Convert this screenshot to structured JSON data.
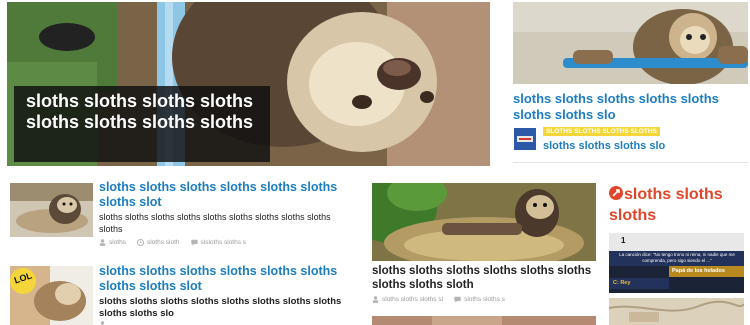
{
  "hero": {
    "caption": "sloths sloths sloths sloths sloths sloths sloths sloths"
  },
  "right_top": {
    "title": "sloths sloths sloths sloths sloths sloths sloths slo",
    "badge": "SLOTHS SLOTHS SLOTHS SLOTHS",
    "sub_title": "sloths sloths sloths slo"
  },
  "list": [
    {
      "title": "sloths sloths sloths sloths sloths sloths sloths slot",
      "desc": "sloths sloths sloths sloths sloths sloths sloths sloths sloths sloths",
      "meta": [
        "sloths",
        "sloths sloth",
        "slsloths sloths s"
      ]
    },
    {
      "badge": "LOL",
      "title": "sloths sloths sloths sloths sloths sloths sloths sloths slot",
      "desc": "sloths sloths sloths sloths sloths sloths sloths sloths sloths sloths slo"
    }
  ],
  "middle": {
    "title": "sloths sloths sloths sloths sloths sloths sloths sloths sloth",
    "meta": [
      "sloths sloths sloths sl",
      "sloths sloths s"
    ]
  },
  "right_col": {
    "heading": "sloths sloths sloths",
    "quiz": {
      "number": "1",
      "question": "La canción dice: \"No tengo trono ni reina, ni nadie que me comprenda, pero sigo siendo el ...\"",
      "answer_d": "Papá de los helados",
      "answer_c": "C: Rey"
    }
  },
  "colors": {
    "link_blue": "#1c7ec2",
    "accent_red": "#e0472a",
    "badge_yellow": "#f4d63a"
  }
}
